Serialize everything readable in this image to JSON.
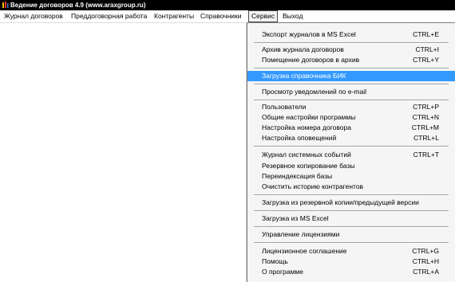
{
  "window": {
    "title": "Ведение договоров 4.9 (www.araxgroup.ru)"
  },
  "menubar": {
    "items": [
      {
        "label": "Журнал договоров"
      },
      {
        "label": "Преддоговорная работа"
      },
      {
        "label": "Контрагенты"
      },
      {
        "label": "Справочники"
      },
      {
        "label": "Сервис"
      },
      {
        "label": "Выход"
      }
    ],
    "active": "Сервис"
  },
  "service_menu": {
    "export_excel": {
      "label": "Экспорт журналов в MS Excel",
      "shortcut": "CTRL+E"
    },
    "archive_journal": {
      "label": "Архив журнала договоров",
      "shortcut": "CTRL+I"
    },
    "move_to_archive": {
      "label": "Помещение договоров в архив",
      "shortcut": "CTRL+Y"
    },
    "load_bik": {
      "label": "Загрузка справочника БИК"
    },
    "view_email": {
      "label": "Просмотр уведомлений по e-mail"
    },
    "users": {
      "label": "Пользователи",
      "shortcut": "CTRL+P"
    },
    "general_settings": {
      "label": "Общие настройки программы",
      "shortcut": "CTRL+N"
    },
    "contract_number": {
      "label": "Настройка номера договора",
      "shortcut": "CTRL+M"
    },
    "alerts": {
      "label": "Настройка оповещений",
      "shortcut": "CTRL+L"
    },
    "system_log": {
      "label": "Журнал системных событий",
      "shortcut": "CTRL+T"
    },
    "backup": {
      "label": "Резервное копирование базы"
    },
    "reindex": {
      "label": "Переиндексация базы"
    },
    "clear_history": {
      "label": "Очистить историю контрагентов"
    },
    "load_backup": {
      "label": "Загрузка из резервной копии/предыдущей версии"
    },
    "load_excel": {
      "label": "Загрузка из MS Excel"
    },
    "licenses": {
      "label": "Управление лицензиями"
    },
    "license_agreement": {
      "label": "Лицензионное соглашение",
      "shortcut": "CTRL+G"
    },
    "help": {
      "label": "Помощь",
      "shortcut": "CTRL+H"
    },
    "about": {
      "label": "О программе",
      "shortcut": "CTRL+A"
    }
  },
  "colors": {
    "highlight": "#3399ff",
    "titlebar": "#000000"
  },
  "icons": {
    "app": "contract-app-icon"
  }
}
